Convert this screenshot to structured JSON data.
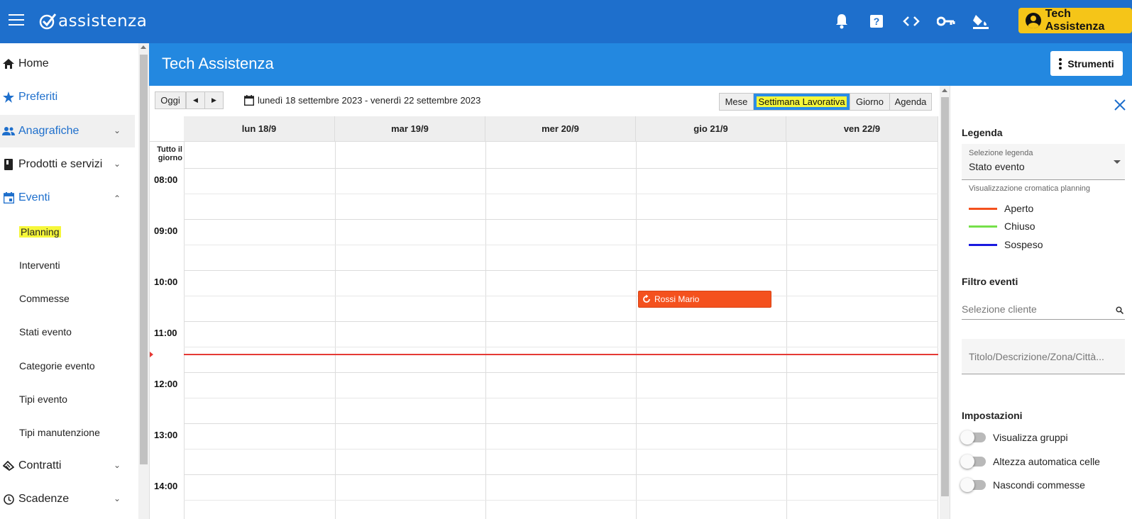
{
  "app": {
    "logo_text": "assistenza",
    "user_name": "Tech Assistenza"
  },
  "topbar": {
    "icons": [
      "bell-icon",
      "help-icon",
      "code-icon",
      "key-icon",
      "paint-bucket-icon"
    ]
  },
  "sidebar": {
    "items": [
      {
        "label": "Home",
        "icon": "home-icon"
      },
      {
        "label": "Preferiti",
        "icon": "star-icon"
      },
      {
        "label": "Anagrafiche",
        "icon": "people-icon"
      },
      {
        "label": "Prodotti e servizi",
        "icon": "book-icon"
      },
      {
        "label": "Eventi",
        "icon": "calendar-icon"
      },
      {
        "label": "Contratti",
        "icon": "contract-icon"
      },
      {
        "label": "Scadenze",
        "icon": "clock-icon"
      }
    ],
    "sub_items": [
      "Planning",
      "Interventi",
      "Commesse",
      "Stati evento",
      "Categorie evento",
      "Tipi evento",
      "Tipi manutenzione"
    ]
  },
  "header": {
    "title": "Tech Assistenza",
    "tools_label": "Strumenti"
  },
  "calendar": {
    "today_label": "Oggi",
    "range": "lunedì 18 settembre 2023 - venerdì 22 settembre 2023",
    "views": [
      "Mese",
      "Settimana Lavorativa",
      "Giorno",
      "Agenda"
    ],
    "active_view": "Settimana Lavorativa",
    "days": [
      "lun 18/9",
      "mar 19/9",
      "mer 20/9",
      "gio 21/9",
      "ven 22/9"
    ],
    "all_day_label": "Tutto il giorno",
    "hours": [
      "08:00",
      "09:00",
      "10:00",
      "11:00",
      "12:00",
      "13:00",
      "14:00"
    ],
    "events": [
      {
        "title": "Rossi Mario",
        "day": "gio 21/9",
        "start": "10:30",
        "color": "#f4511e"
      }
    ]
  },
  "panel": {
    "legend_title": "Legenda",
    "select_label": "Selezione legenda",
    "select_value": "Stato evento",
    "hint": "Visualizzazione cromatica planning",
    "legend": [
      {
        "label": "Aperto",
        "color": "#f4511e"
      },
      {
        "label": "Chiuso",
        "color": "#76e04a"
      },
      {
        "label": "Sospeso",
        "color": "#1a1adf"
      }
    ],
    "filter_title": "Filtro eventi",
    "client_placeholder": "Selezione cliente",
    "search_placeholder": "Titolo/Descrizione/Zona/Città...",
    "settings_title": "Impostazioni",
    "toggles": [
      "Visualizza gruppi",
      "Altezza automatica celle",
      "Nascondi commesse"
    ]
  }
}
